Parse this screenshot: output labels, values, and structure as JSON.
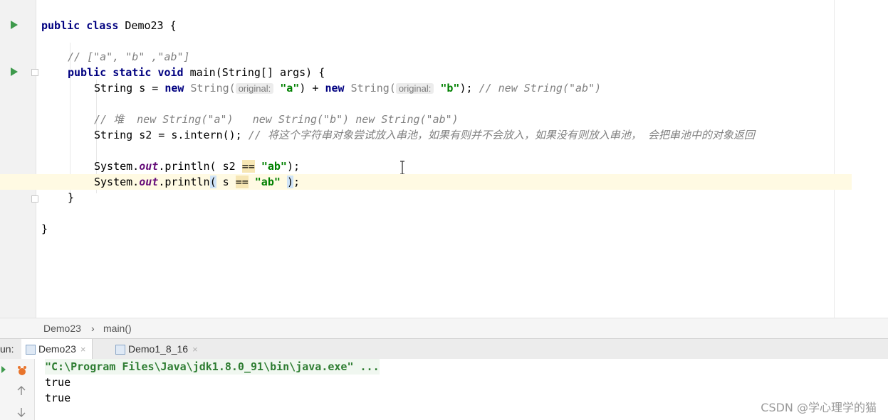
{
  "code_lines": [
    {
      "kind": "class_decl",
      "kw1": "public",
      "kw2": "class",
      "name": " Demo23 {"
    },
    {
      "kind": "comment",
      "text": "// [\"a\", \"b\" ,\"ab\"]"
    },
    {
      "kind": "method_decl",
      "kw1": "public",
      "kw2": "static",
      "kw3": "void",
      "rest": " main(String[] args) {"
    },
    {
      "kind": "stmt1",
      "p1": "String s = ",
      "new1": "new",
      "p2": " String(",
      "hint1": "original:",
      "s1": "\"a\"",
      "p3": ") + ",
      "new2": "new",
      "p4": " String(",
      "hint2": "original:",
      "s2": "\"b\"",
      "p5": "); ",
      "comment": "// new String(\"ab\")"
    },
    {
      "kind": "comment2",
      "text": "// 堆  new String(\"a\")   new String(\"b\") new String(\"ab\")"
    },
    {
      "kind": "stmt2",
      "p1": "String s2 = s.intern(); ",
      "comment": "// 将这个字符串对象尝试放入串池，如果有则并不会放入，如果没有则放入串池， 会把串池中的对象返回"
    },
    {
      "kind": "print1",
      "p1": "System.",
      "fld": "out",
      "p2": ".println( s2 ",
      "eq": "==",
      "sp": " ",
      "str": "\"ab\"",
      "p3": ");"
    },
    {
      "kind": "print2",
      "p1": "System.",
      "fld": "out",
      "p2": ".println",
      "par1": "(",
      "p3": " s ",
      "eq": "==",
      "sp": " ",
      "str": "\"ab\"",
      "sp2": " ",
      "par2": ")",
      "p4": ";"
    },
    {
      "kind": "close1",
      "text": "}"
    },
    {
      "kind": "close2",
      "text": "}"
    }
  ],
  "breadcrumbs": {
    "class": "Demo23",
    "sep": "›",
    "method": "main()"
  },
  "run_panel": {
    "label": "un:",
    "tabs": [
      {
        "label": "Demo23",
        "close": "×"
      },
      {
        "label": "Demo1_8_16",
        "close": "×"
      }
    ],
    "output": [
      "\"C:\\Program Files\\Java\\jdk1.8.0_91\\bin\\java.exe\" ...",
      "true",
      "true"
    ]
  },
  "watermark": "CSDN @学心理学的猫",
  "colors": {
    "keyword": "#000080",
    "string": "#008000",
    "comment": "#808080",
    "run_icon": "#3e9a4c"
  }
}
